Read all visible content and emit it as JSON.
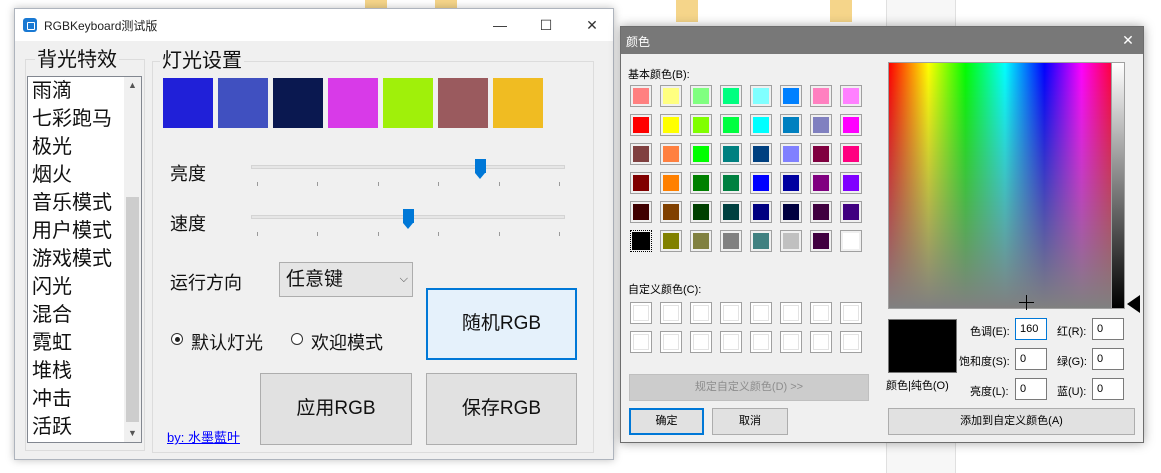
{
  "main_window": {
    "title": "RGBKeyboard测试版",
    "controls": {
      "minimize": "—",
      "maximize": "☐",
      "close": "✕"
    },
    "effects_group_title": "背光特效",
    "effects": [
      "雨滴",
      "七彩跑马",
      "极光",
      "烟火",
      "音乐模式",
      "用户模式",
      "游戏模式",
      "闪光",
      "混合",
      "霓虹",
      "堆栈",
      "冲击",
      "活跃"
    ],
    "light_group_title": "灯光设置",
    "swatches": [
      "#2020d8",
      "#4050c0",
      "#0a1850",
      "#d83ae8",
      "#a0f00a",
      "#9a5a5e",
      "#f0bc22"
    ],
    "brightness_label": "亮度",
    "brightness_value": 0.74,
    "speed_label": "速度",
    "speed_value": 0.5,
    "direction_label": "运行方向",
    "direction_value": "任意键",
    "radio_default": "默认灯光",
    "radio_welcome": "欢迎模式",
    "random_button": "随机RGB",
    "apply_button": "应用RGB",
    "save_button": "保存RGB",
    "author_link": "by: 水墨藍叶"
  },
  "color_dialog": {
    "title": "颜色",
    "close": "✕",
    "basic_label": "基本颜色(B):",
    "basic_colors": [
      [
        "#ff8080",
        "#ffff80",
        "#80ff80",
        "#00ff80",
        "#80ffff",
        "#0080ff",
        "#ff80c0",
        "#ff80ff"
      ],
      [
        "#ff0000",
        "#ffff00",
        "#80ff00",
        "#00ff40",
        "#00ffff",
        "#0080c0",
        "#8080c0",
        "#ff00ff"
      ],
      [
        "#804040",
        "#ff8040",
        "#00ff00",
        "#008080",
        "#004080",
        "#8080ff",
        "#800040",
        "#ff0080"
      ],
      [
        "#800000",
        "#ff8000",
        "#008000",
        "#008040",
        "#0000ff",
        "#0000a0",
        "#800080",
        "#8000ff"
      ],
      [
        "#400000",
        "#804000",
        "#004000",
        "#004040",
        "#000080",
        "#000040",
        "#400040",
        "#400080"
      ],
      [
        "#000000",
        "#808000",
        "#808040",
        "#808080",
        "#408080",
        "#c0c0c0",
        "#400040",
        "#ffffff"
      ]
    ],
    "custom_label": "自定义颜色(C):",
    "define_custom_button": "规定自定义颜色(D) >>",
    "ok_button": "确定",
    "cancel_button": "取消",
    "add_custom_button": "添加到自定义颜色(A)",
    "solid_label": "颜色|纯色(O)",
    "hue_label": "色调(E):",
    "hue_value": "160",
    "sat_label": "饱和度(S):",
    "sat_value": "0",
    "lum_label": "亮度(L):",
    "lum_value": "0",
    "red_label": "红(R):",
    "red_value": "0",
    "green_label": "绿(G):",
    "green_value": "0",
    "blue_label": "蓝(U):",
    "blue_value": "0"
  }
}
